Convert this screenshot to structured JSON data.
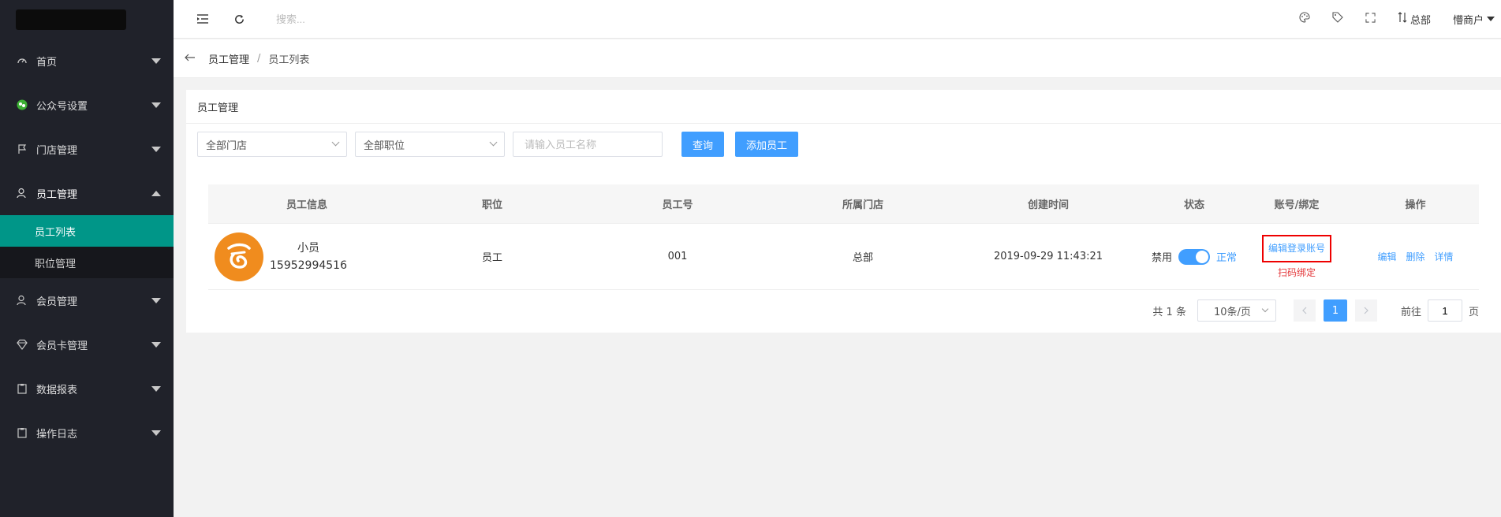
{
  "header": {
    "search_placeholder": "搜索...",
    "org_label": "总部",
    "merchant_label": "懵商户"
  },
  "sidebar": {
    "items": [
      {
        "label": "首页",
        "icon": "dashboard-icon"
      },
      {
        "label": "公众号设置",
        "icon": "wechat-icon"
      },
      {
        "label": "门店管理",
        "icon": "flag-icon"
      },
      {
        "label": "员工管理",
        "icon": "user-icon"
      },
      {
        "label": "会员管理",
        "icon": "user-icon"
      },
      {
        "label": "会员卡管理",
        "icon": "diamond-icon"
      },
      {
        "label": "数据报表",
        "icon": "clipboard-icon"
      },
      {
        "label": "操作日志",
        "icon": "clipboard-icon"
      }
    ],
    "subitems": [
      {
        "label": "员工列表"
      },
      {
        "label": "职位管理"
      }
    ]
  },
  "breadcrumb": {
    "parent": "员工管理",
    "sep": "/",
    "current": "员工列表"
  },
  "card": {
    "title": "员工管理"
  },
  "filters": {
    "store": "全部门店",
    "position": "全部职位",
    "name_placeholder": "请输入员工名称",
    "query": "查询",
    "add": "添加员工"
  },
  "table": {
    "headers": [
      "员工信息",
      "职位",
      "员工号",
      "所属门店",
      "创建时间",
      "状态",
      "账号/绑定",
      "操作"
    ],
    "rows": [
      {
        "name": "小员",
        "phone": "15952994516",
        "position": "员工",
        "number": "001",
        "store": "总部",
        "created": "2019-09-29 11:43:21",
        "status_off": "禁用",
        "status_on": "正常",
        "edit_login": "编辑登录账号",
        "scan_bind": "扫码绑定",
        "op_edit": "编辑",
        "op_delete": "删除",
        "op_detail": "详情"
      }
    ]
  },
  "pagination": {
    "total": "共 1 条",
    "page_size": "10条/页",
    "current_page": "1",
    "goto_label": "前往",
    "goto_value": "1",
    "page_suffix": "页"
  },
  "colors": {
    "accent": "#409eff",
    "active_menu": "#009688",
    "sidebar_bg": "#20222a",
    "highlight_border": "#ee0000",
    "avatar_bg": "#f08c1e"
  }
}
